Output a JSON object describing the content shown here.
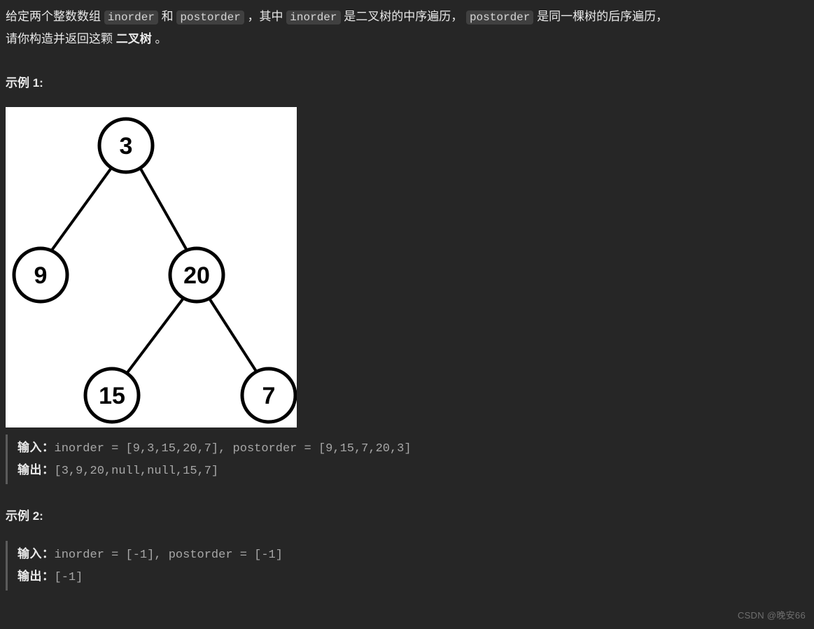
{
  "intro": {
    "p1_pre": "给定两个整数数组 ",
    "code_inorder": "inorder",
    "p1_mid1": " 和 ",
    "code_postorder": "postorder",
    "p1_mid2": " ，其中 ",
    "p1_mid3": " 是二叉树的中序遍历， ",
    "p1_mid4": " 是同一棵树的后序遍历，",
    "p2_pre": "请你构造并返回这颗 ",
    "p2_bold": "二叉树",
    "p2_post": " 。"
  },
  "example1": {
    "title": "示例 1:",
    "input_label": "输入：",
    "input_value": "inorder = [9,3,15,20,7], postorder = [9,15,7,20,3]",
    "output_label": "输出：",
    "output_value": "[3,9,20,null,null,15,7]"
  },
  "example2": {
    "title": "示例 2:",
    "input_label": "输入：",
    "input_value": "inorder = [-1], postorder = [-1]",
    "output_label": "输出：",
    "output_value": "[-1]"
  },
  "tree": {
    "nodes": {
      "root": "3",
      "left": "9",
      "right": "20",
      "right_left": "15",
      "right_right": "7"
    }
  },
  "watermark": "CSDN @晚安66"
}
